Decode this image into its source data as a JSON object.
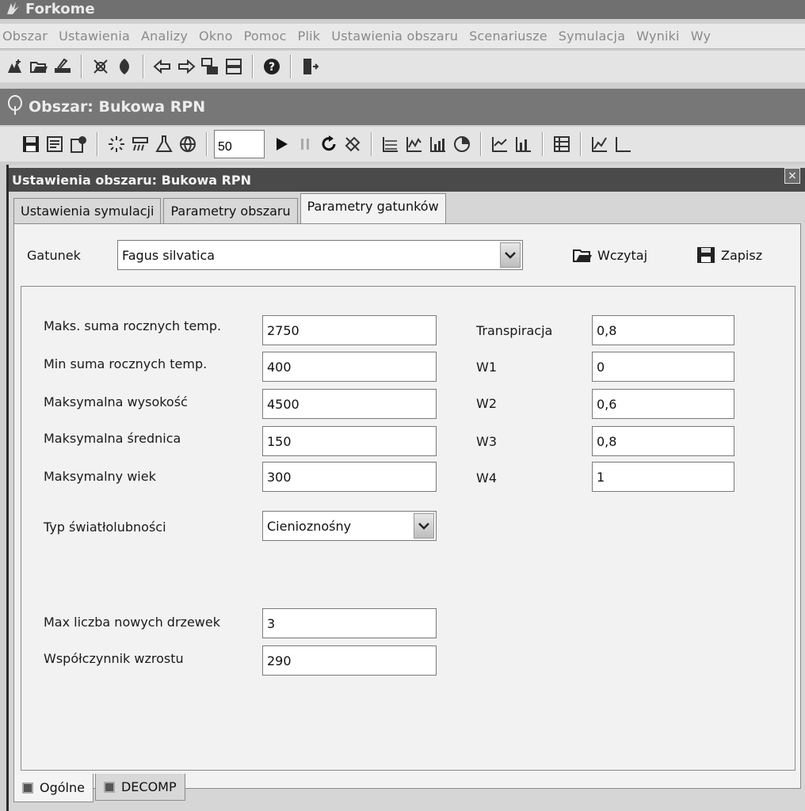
{
  "app": {
    "title": "Forkome"
  },
  "menu": [
    "Obszar",
    "Ustawienia",
    "Analizy",
    "Okno",
    "Pomoc",
    "Plik",
    "Ustawienia obszaru",
    "Scenariusze",
    "Symulacja",
    "Wyniki",
    "Wy"
  ],
  "inner_window": {
    "title": "Obszar: Bukowa RPN"
  },
  "toolbar2": {
    "step_value": "50"
  },
  "dialog": {
    "title": "Ustawienia obszaru: Bukowa RPN",
    "close_glyph": "×",
    "tabs": [
      "Ustawienia symulacji",
      "Parametry obszaru",
      "Parametry gatunków"
    ],
    "active_tab": "Parametry gatunków",
    "species_label": "Gatunek",
    "species_value": "Fagus silvatica",
    "load_label": "Wczytaj",
    "save_label": "Zapisz",
    "left_params": [
      {
        "label": "Maks. suma rocznych temp.",
        "value": "2750"
      },
      {
        "label": "Min suma rocznych temp.",
        "value": "400"
      },
      {
        "label": "Maksymalna wysokość",
        "value": "4500"
      },
      {
        "label": "Maksymalna średnica",
        "value": "150"
      },
      {
        "label": "Maksymalny wiek",
        "value": "300"
      }
    ],
    "right_params": [
      {
        "label": "Transpiracja",
        "value": "0,8"
      },
      {
        "label": "W1",
        "value": "0"
      },
      {
        "label": "W2",
        "value": "0,6"
      },
      {
        "label": "W3",
        "value": "0,8"
      },
      {
        "label": "W4",
        "value": "1"
      }
    ],
    "light_type_label": "Typ światłolubności",
    "light_type_value": "Cienioznośny",
    "max_new_trees_label": "Max liczba nowych drzewek",
    "max_new_trees_value": "3",
    "growth_coef_label": "Współczynnik wzrostu",
    "growth_coef_value": "290",
    "bottom_tabs": [
      "Ogólne",
      "DECOMP"
    ]
  }
}
